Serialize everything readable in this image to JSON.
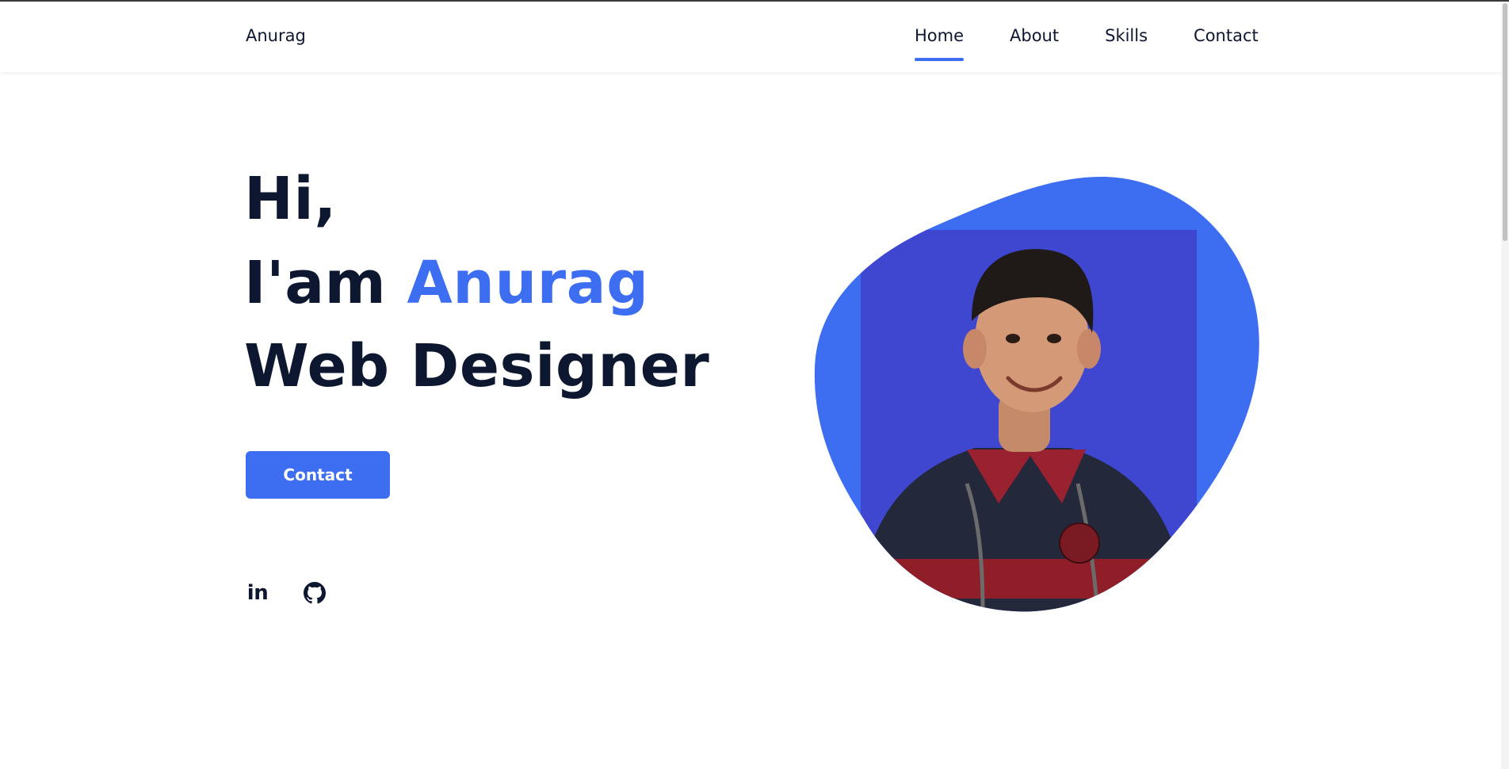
{
  "header": {
    "brand": "Anurag",
    "nav": [
      {
        "label": "Home",
        "active": true
      },
      {
        "label": "About",
        "active": false
      },
      {
        "label": "Skills",
        "active": false
      },
      {
        "label": "Contact",
        "active": false
      }
    ]
  },
  "hero": {
    "greeting": "Hi,",
    "intro_prefix": "I'am",
    "name": "Anurag",
    "role": "Web Designer",
    "cta_label": "Contact"
  },
  "socials": [
    {
      "icon": "linkedin-icon"
    },
    {
      "icon": "github-icon"
    }
  ],
  "colors": {
    "accent": "#3d6ef2",
    "text": "#0e1730",
    "photo_bg": "#3f47d1"
  }
}
